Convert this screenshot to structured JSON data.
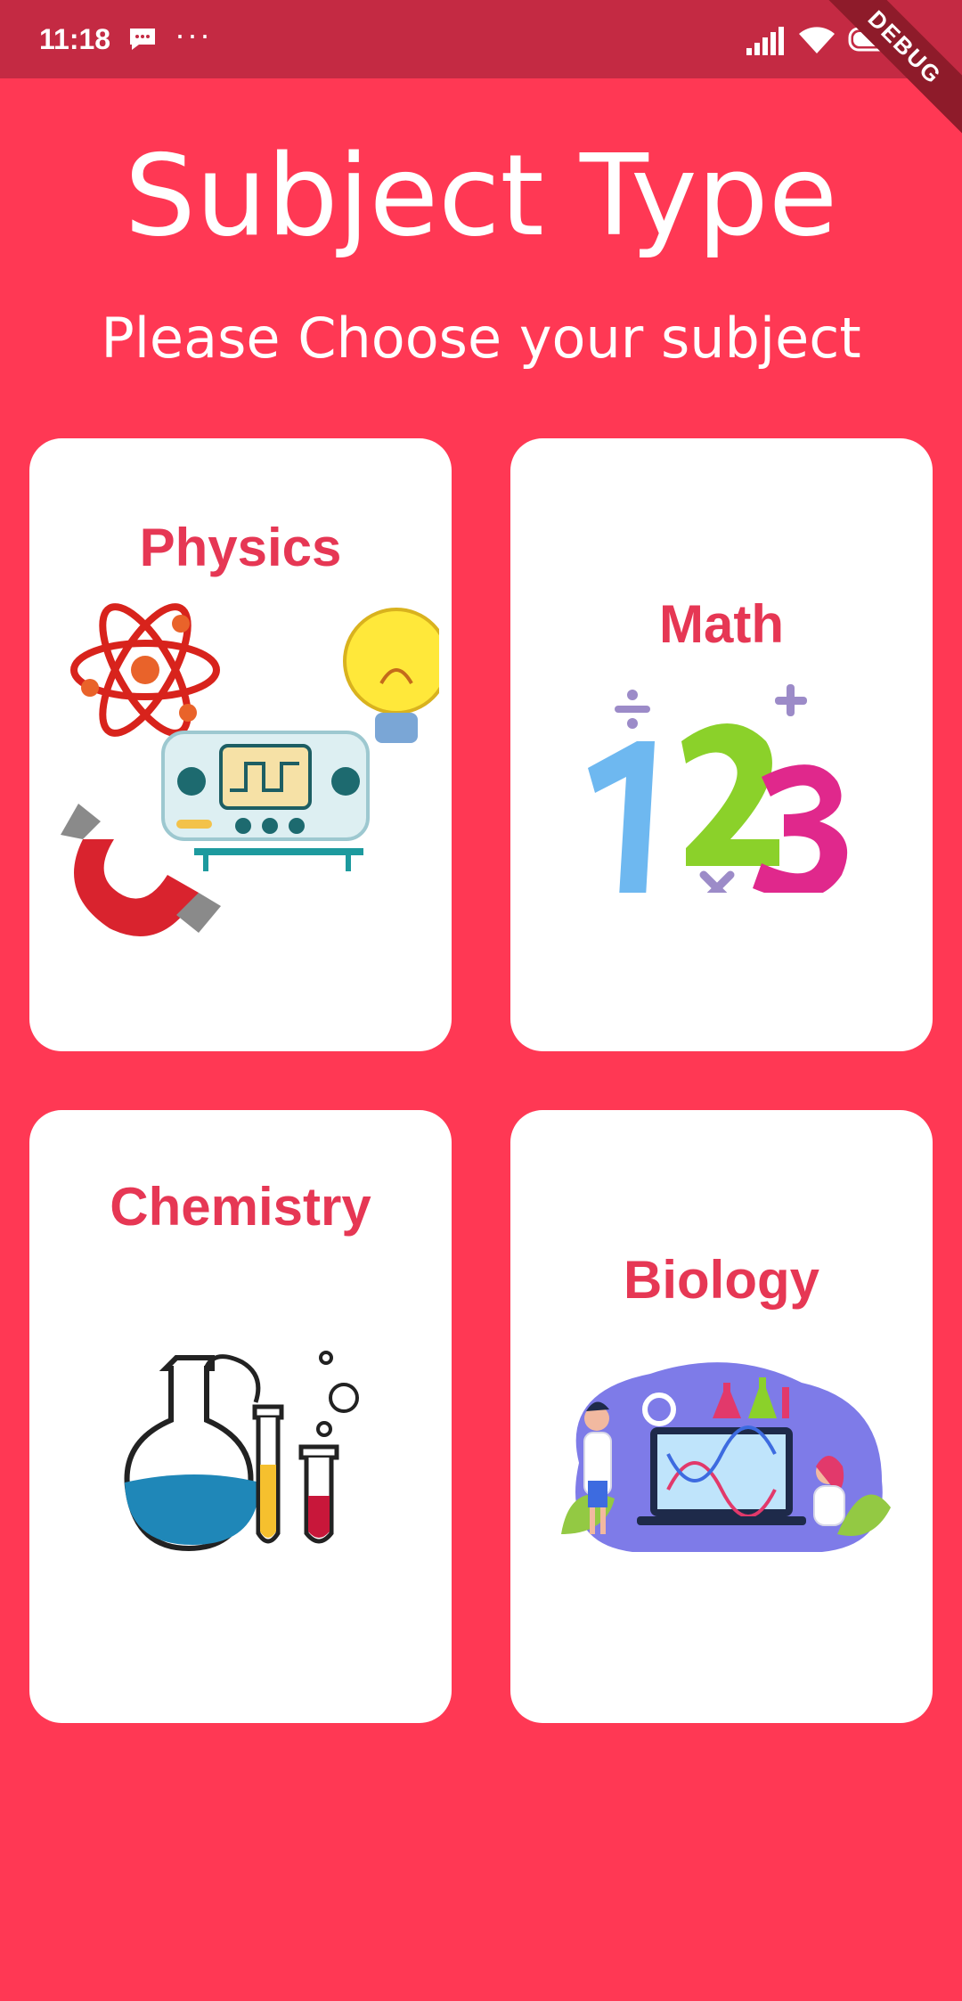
{
  "status_bar": {
    "time": "11:18",
    "dots": "···",
    "debug_label": "DEBUG"
  },
  "header": {
    "title": "Subject Type",
    "subtitle": "Please Choose your subject"
  },
  "subjects": [
    {
      "label": "Physics",
      "icon": "physics-illustration"
    },
    {
      "label": "Math",
      "icon": "math-123-illustration"
    },
    {
      "label": "Chemistry",
      "icon": "chemistry-lab-illustration"
    },
    {
      "label": "Biology",
      "icon": "biology-lab-illustration"
    }
  ],
  "colors": {
    "background": "#FF3854",
    "status_bar": "#C42A43",
    "card": "#FFFFFF",
    "label": "#E63754"
  }
}
